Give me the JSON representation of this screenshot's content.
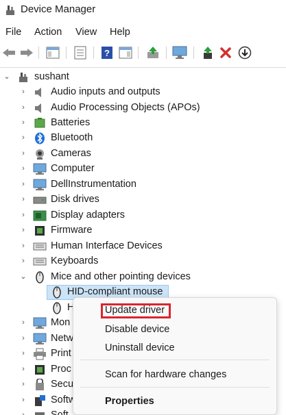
{
  "window": {
    "title": "Device Manager"
  },
  "menubar": {
    "items": [
      "File",
      "Action",
      "View",
      "Help"
    ]
  },
  "tree": {
    "root": "sushant",
    "categories": [
      "Audio inputs and outputs",
      "Audio Processing Objects (APOs)",
      "Batteries",
      "Bluetooth",
      "Cameras",
      "Computer",
      "DellInstrumentation",
      "Disk drives",
      "Display adapters",
      "Firmware",
      "Human Interface Devices",
      "Keyboards",
      "Mice and other pointing devices"
    ],
    "mice_children": [
      "HID-compliant mouse",
      "H"
    ],
    "partial_categories": [
      "Mon",
      "Netw",
      "Print",
      "Proc",
      "Secu",
      "Softw",
      "Soft"
    ]
  },
  "context_menu": {
    "items": [
      "Update driver",
      "Disable device",
      "Uninstall device",
      "Scan for hardware changes",
      "Properties"
    ]
  },
  "colors": {
    "highlight_border": "#d8262f",
    "selection_bg": "#cce4f7",
    "uninstall_x": "#d32f2f",
    "toolbar_green": "#2e9e3e"
  }
}
